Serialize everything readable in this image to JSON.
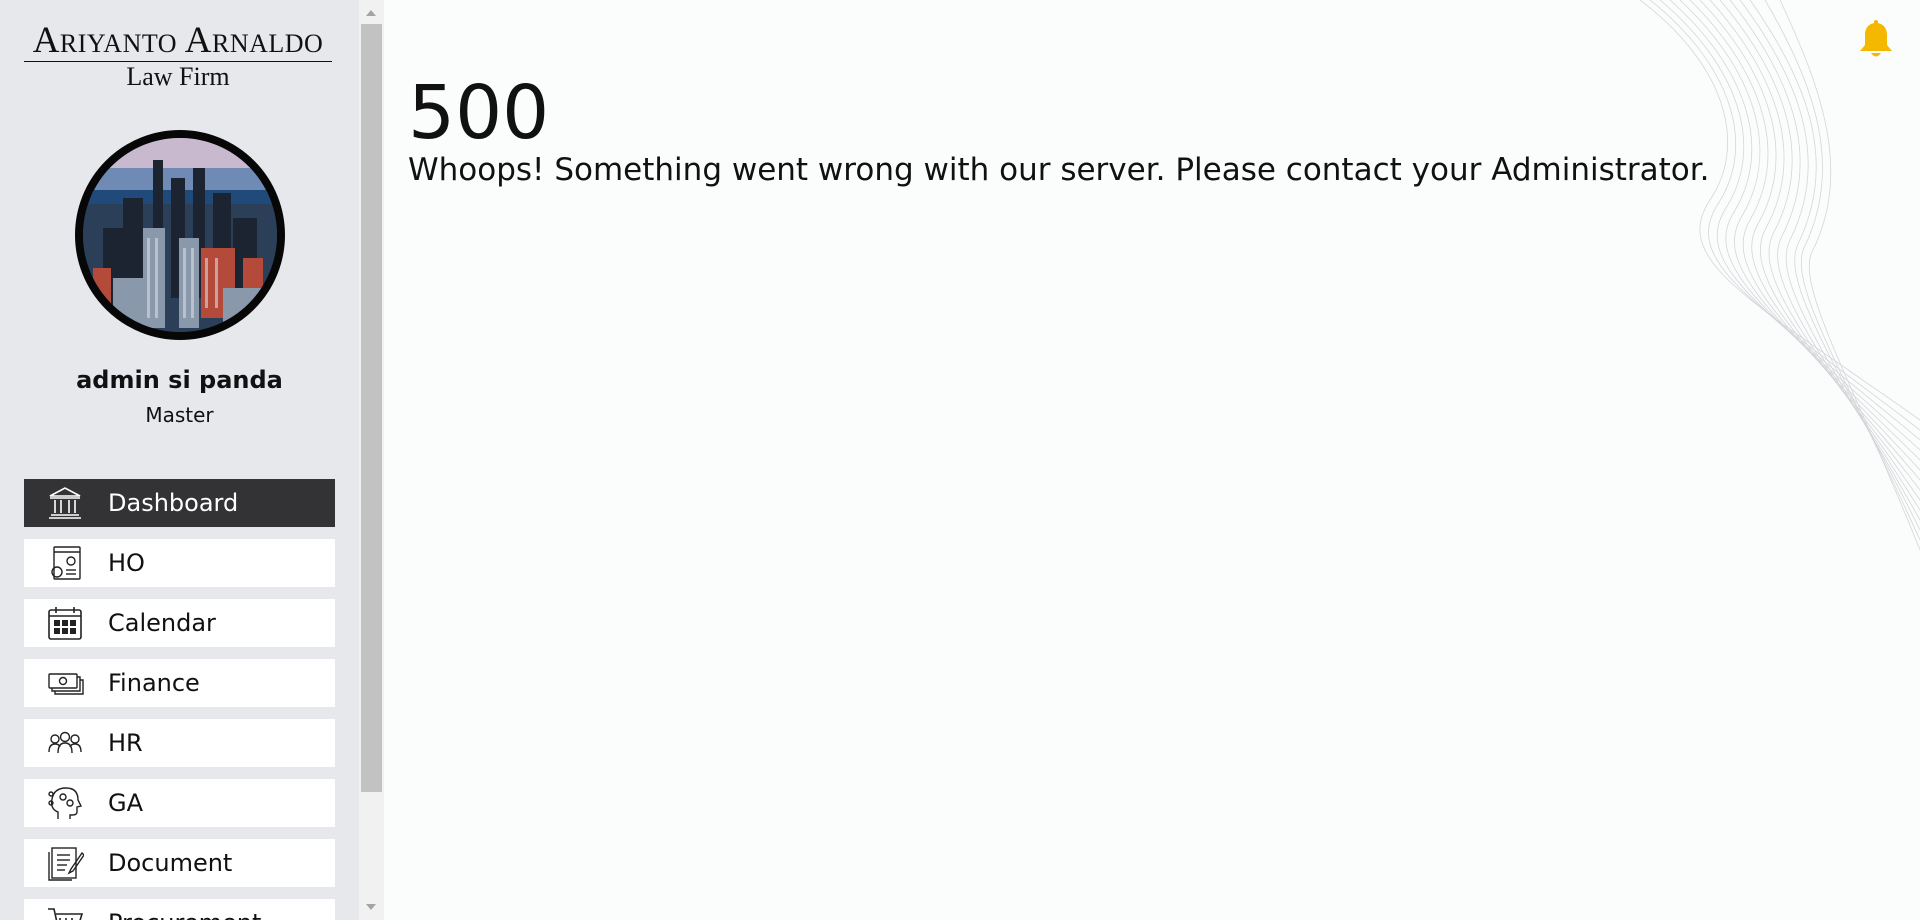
{
  "brand": {
    "name": "Ariyanto Arnaldo",
    "subtitle": "Law Firm"
  },
  "user": {
    "name": "admin si panda",
    "role": "Master",
    "avatar_icon": "city-skyline-photo"
  },
  "nav": {
    "items": [
      {
        "label": "Dashboard",
        "icon": "bank-building-icon",
        "active": true
      },
      {
        "label": "HO",
        "icon": "settings-document-icon"
      },
      {
        "label": "Calendar",
        "icon": "calendar-icon"
      },
      {
        "label": "Finance",
        "icon": "money-bills-icon"
      },
      {
        "label": "HR",
        "icon": "people-group-icon"
      },
      {
        "label": "GA",
        "icon": "head-gears-icon"
      },
      {
        "label": "Document",
        "icon": "document-edit-icon"
      },
      {
        "label": "Procurement",
        "icon": "cart-icon"
      }
    ]
  },
  "header": {
    "notification_icon": "bell-icon",
    "notification_color": "#f5b800"
  },
  "error": {
    "code": "500",
    "message": "Whoops! Something went wrong with our server. Please contact your Administrator."
  },
  "colors": {
    "sidebar_bg": "#e6e8ec",
    "active_item_bg": "#333336",
    "page_bg": "#fbfcfc"
  }
}
